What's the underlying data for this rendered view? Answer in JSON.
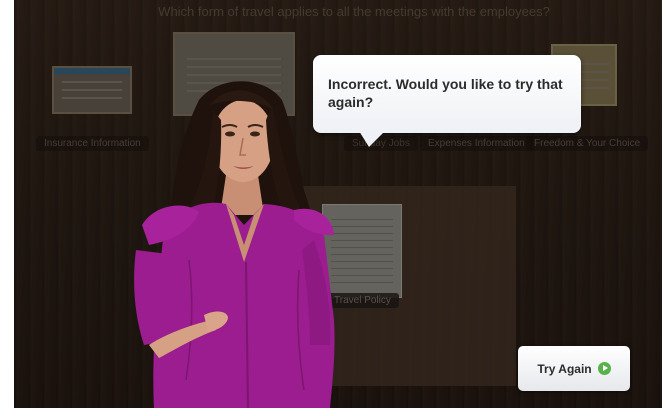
{
  "background": {
    "banner_text": "Which form of travel applies to all the meetings with the employees?",
    "documents": [
      {
        "label": "Insurance Information"
      },
      {
        "label": "Sunday Jobs"
      },
      {
        "label": "Expenses Information"
      },
      {
        "label": "Freedom & Your Choice"
      }
    ],
    "center_doc_label": "Travel Policy"
  },
  "dialog": {
    "message": "Incorrect. Would you like to try that again?"
  },
  "actions": {
    "try_again_label": "Try Again",
    "try_again_icon": "arrow-right-circle-icon"
  },
  "colors": {
    "blouse": "#9b1d8f",
    "go_green": "#58b14a"
  }
}
